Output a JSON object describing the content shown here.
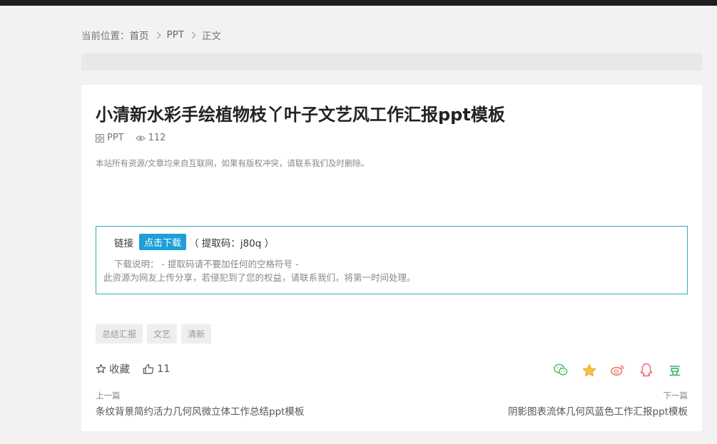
{
  "breadcrumb": {
    "prefix": "当前位置：",
    "home": "首页",
    "category": "PPT",
    "current": "正文"
  },
  "article": {
    "title": "小清新水彩手绘植物枝丫叶子文艺风工作汇报ppt模板",
    "category": "PPT",
    "views": "112",
    "notice": "本站所有资源/文章均来自互联网，如果有版权冲突，请联系我们及时删除。"
  },
  "download": {
    "link_label": "链接",
    "button_label": "点击下载",
    "code_text": "（ 提取码：j80q ）",
    "desc_label": "下载说明：",
    "desc_text": " - 提取码请不要加任何的空格符号 -",
    "note": "此资源为网友上传分享，若侵犯到了您的权益，请联系我们，将第一时间处理。"
  },
  "tags": [
    "总结汇报",
    "文艺",
    "清新"
  ],
  "actions": {
    "favorite_label": "收藏",
    "like_count": "11"
  },
  "share": {
    "icons": [
      "wechat-icon",
      "star-icon",
      "weibo-icon",
      "qq-icon",
      "douban-icon"
    ],
    "colors": {
      "wechat": "#5cc66f",
      "star": "#f5c242",
      "weibo": "#f07a6f",
      "qq": "#f07a8a",
      "douban": "#4cb872"
    },
    "douban_glyph": "豆"
  },
  "post_nav": {
    "prev_label": "上一篇",
    "prev_title": "条纹背景简约活力几何风微立体工作总结ppt模板",
    "next_label": "下一篇",
    "next_title": "阴影图表流体几何风蓝色工作汇报ppt模板"
  },
  "colors": {
    "accent": "#1e9fd9",
    "box_border": "#39a8b8"
  }
}
